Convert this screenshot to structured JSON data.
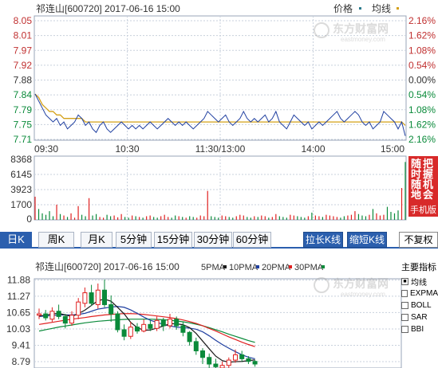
{
  "intraday": {
    "title": "祁连山[600720] 2017-06-16 15:00",
    "legend_price": "价格",
    "legend_avg": "均线",
    "watermark_main": "东方财富网",
    "watermark_sub": "eastmoney.com"
  },
  "kline_header": {
    "title": "祁连山[600720] 2017-06-16 15:00",
    "ma5": "5PMA",
    "ma10": "10PMA",
    "ma20": "20PMA",
    "ma30": "30PMA"
  },
  "tabs": [
    "日K",
    "周K",
    "月K",
    "5分钟",
    "15分钟",
    "30分钟",
    "60分钟"
  ],
  "buttons": {
    "stretch": "拉长K线",
    "shrink": "缩短K线",
    "restore": "不复权"
  },
  "ad": {
    "col1": "随时随地",
    "col2": "把握机会",
    "foot": "手机版"
  },
  "indicators": {
    "title": "主要指标",
    "items": [
      {
        "label": "均线",
        "checked": true
      },
      {
        "label": "EXPMA",
        "checked": false
      },
      {
        "label": "BOLL",
        "checked": false
      },
      {
        "label": "SAR",
        "checked": false
      },
      {
        "label": "BBI",
        "checked": false
      }
    ]
  },
  "colors": {
    "price": "#1f3fa0",
    "avg": "#d4a017",
    "up": "#e02020",
    "down": "#0a8a3a",
    "grid": "#c8d0dc"
  },
  "chart_data": [
    {
      "type": "line",
      "name": "intraday-price",
      "y_ticks": [
        "8.05",
        "8.01",
        "7.97",
        "7.92",
        "7.88",
        "7.84",
        "7.79",
        "7.75",
        "7.71"
      ],
      "pct_ticks": [
        "2.16%",
        "1.62%",
        "1.08%",
        "0.54%",
        "0.00%",
        "0.54%",
        "1.08%",
        "1.62%",
        "2.16%"
      ],
      "x_ticks": [
        "09:30",
        "10:30",
        "11:30/13:00",
        "14:00",
        "15:00"
      ],
      "ylim": [
        7.71,
        8.05
      ],
      "price": [
        7.84,
        7.82,
        7.8,
        7.78,
        7.77,
        7.76,
        7.77,
        7.75,
        7.76,
        7.74,
        7.75,
        7.76,
        7.78,
        7.77,
        7.75,
        7.76,
        7.74,
        7.73,
        7.75,
        7.76,
        7.74,
        7.73,
        7.74,
        7.75,
        7.76,
        7.75,
        7.74,
        7.75,
        7.74,
        7.75,
        7.74,
        7.75,
        7.76,
        7.75,
        7.74,
        7.75,
        7.76,
        7.77,
        7.76,
        7.75,
        7.76,
        7.75,
        7.76,
        7.75,
        7.74,
        7.75,
        7.76,
        7.77,
        7.79,
        7.78,
        7.77,
        7.76,
        7.77,
        7.78,
        7.76,
        7.75,
        7.76,
        7.77,
        7.79,
        7.77,
        7.76,
        7.77,
        7.76,
        7.77,
        7.78,
        7.76,
        7.77,
        7.79,
        7.76,
        7.75,
        7.74,
        7.76,
        7.78,
        7.77,
        7.76,
        7.75,
        7.76,
        7.74,
        7.75,
        7.76,
        7.75,
        7.76,
        7.77,
        7.78,
        7.79,
        7.77,
        7.76,
        7.77,
        7.78,
        7.79,
        7.78,
        7.76,
        7.75,
        7.76,
        7.74,
        7.75,
        7.76,
        7.79,
        7.78,
        7.77,
        7.76,
        7.74,
        7.76,
        7.72
      ],
      "avg": [
        7.84,
        7.83,
        7.81,
        7.8,
        7.79,
        7.79,
        7.78,
        7.78,
        7.77,
        7.77,
        7.77,
        7.77,
        7.77,
        7.77,
        7.76,
        7.76,
        7.76,
        7.76,
        7.76,
        7.76,
        7.76,
        7.76,
        7.76,
        7.76,
        7.76,
        7.76,
        7.76,
        7.76,
        7.76,
        7.76,
        7.76,
        7.76,
        7.76,
        7.76,
        7.76,
        7.76,
        7.76,
        7.76,
        7.76,
        7.76,
        7.76,
        7.76,
        7.76,
        7.76,
        7.76,
        7.76,
        7.76,
        7.76,
        7.76,
        7.76,
        7.76,
        7.76,
        7.76,
        7.76,
        7.76,
        7.76,
        7.76,
        7.76,
        7.76,
        7.76,
        7.76,
        7.76,
        7.76,
        7.76,
        7.76,
        7.76,
        7.76,
        7.76,
        7.76,
        7.76,
        7.76,
        7.76,
        7.76,
        7.76,
        7.76,
        7.76,
        7.76,
        7.76,
        7.76,
        7.76,
        7.76,
        7.76,
        7.76,
        7.76,
        7.76,
        7.76,
        7.76,
        7.76,
        7.76,
        7.76,
        7.76,
        7.76,
        7.76,
        7.76,
        7.76,
        7.76,
        7.76,
        7.76,
        7.76,
        7.76,
        7.76,
        7.76,
        7.76,
        7.75
      ]
    },
    {
      "type": "bar",
      "name": "intraday-volume",
      "y_ticks": [
        "8368",
        "6145",
        "3923",
        "1700",
        "0"
      ],
      "ylim": [
        0,
        8368
      ],
      "values": [
        3200,
        1500,
        900,
        700,
        1200,
        500,
        2100,
        800,
        600,
        400,
        900,
        300,
        1900,
        700,
        500,
        3000,
        600,
        800,
        400,
        300,
        700,
        500,
        600,
        350,
        800,
        400,
        300,
        600,
        500,
        400,
        300,
        500,
        600,
        400,
        300,
        500,
        700,
        400,
        300,
        600,
        500,
        400,
        300,
        500,
        400,
        300,
        600,
        500,
        4000,
        500,
        400,
        300,
        600,
        500,
        400,
        300,
        500,
        700,
        600,
        400,
        300,
        500,
        400,
        600,
        500,
        300,
        400,
        800,
        500,
        400,
        300,
        700,
        600,
        500,
        400,
        300,
        500,
        1000,
        600,
        500,
        400,
        700,
        600,
        500,
        400,
        300,
        500,
        600,
        700,
        1200,
        800,
        600,
        500,
        700,
        1500,
        900,
        600,
        700,
        1800,
        1100,
        900,
        1300,
        4400,
        8000
      ]
    },
    {
      "type": "candlestick",
      "name": "daily-kline",
      "y_ticks": [
        "11.88",
        "11.27",
        "10.65",
        "10.03",
        "9.41",
        "8.79"
      ],
      "ylim": [
        8.55,
        12.05
      ],
      "candles": [
        [
          10.55,
          10.6,
          10.8,
          10.4
        ],
        [
          10.6,
          10.45,
          10.75,
          10.35
        ],
        [
          10.4,
          10.7,
          10.85,
          10.3
        ],
        [
          10.7,
          10.5,
          10.95,
          10.4
        ],
        [
          10.5,
          10.25,
          10.6,
          10.05
        ],
        [
          10.25,
          10.55,
          10.7,
          10.15
        ],
        [
          10.55,
          11.05,
          11.2,
          10.4
        ],
        [
          11.0,
          11.4,
          11.6,
          10.85
        ],
        [
          11.4,
          11.0,
          11.7,
          10.9
        ],
        [
          10.95,
          11.5,
          11.75,
          10.8
        ],
        [
          11.5,
          10.95,
          11.9,
          10.85
        ],
        [
          10.95,
          10.6,
          11.3,
          10.3
        ],
        [
          10.6,
          10.0,
          10.7,
          9.9
        ],
        [
          10.0,
          9.75,
          10.2,
          9.6
        ],
        [
          9.75,
          10.1,
          10.3,
          9.65
        ],
        [
          10.1,
          9.95,
          10.25,
          9.85
        ],
        [
          9.95,
          10.2,
          10.4,
          9.9
        ],
        [
          10.2,
          10.05,
          10.35,
          9.95
        ],
        [
          10.05,
          10.35,
          10.5,
          9.95
        ],
        [
          10.35,
          10.15,
          10.45,
          9.95
        ],
        [
          10.15,
          10.4,
          10.6,
          10.05
        ],
        [
          10.4,
          10.15,
          10.5,
          10.0
        ],
        [
          10.15,
          9.9,
          10.3,
          9.75
        ],
        [
          9.9,
          9.55,
          9.95,
          9.4
        ],
        [
          9.55,
          9.2,
          9.7,
          9.05
        ],
        [
          9.2,
          8.95,
          9.3,
          8.7
        ],
        [
          8.95,
          8.7,
          9.1,
          8.55
        ],
        [
          8.7,
          8.6,
          8.9,
          8.45
        ],
        [
          8.55,
          8.65,
          8.8,
          8.45
        ],
        [
          8.65,
          8.85,
          8.95,
          8.55
        ],
        [
          8.85,
          9.05,
          9.25,
          8.75
        ],
        [
          9.05,
          8.9,
          9.2,
          8.8
        ],
        [
          8.9,
          8.8,
          9.0,
          8.7
        ],
        [
          8.8,
          8.7,
          8.85,
          8.6
        ]
      ],
      "ma5": [
        10.52,
        10.55,
        10.6,
        10.62,
        10.56,
        10.5,
        10.61,
        10.74,
        10.92,
        11.1,
        11.16,
        11.08,
        10.85,
        10.6,
        10.28,
        10.08,
        9.98,
        9.99,
        10.06,
        10.14,
        10.23,
        10.22,
        10.19,
        10.08,
        9.86,
        9.57,
        9.28,
        9.0,
        8.83,
        8.77,
        8.79,
        8.8,
        8.83,
        8.86
      ],
      "ma10": [
        10.5,
        10.52,
        10.54,
        10.56,
        10.56,
        10.56,
        10.58,
        10.62,
        10.7,
        10.78,
        10.82,
        10.86,
        10.88,
        10.85,
        10.75,
        10.62,
        10.48,
        10.36,
        10.28,
        10.2,
        10.14,
        10.1,
        10.08,
        10.06,
        10.02,
        9.92,
        9.77,
        9.6,
        9.44,
        9.3,
        9.17,
        9.05,
        8.96,
        8.9
      ],
      "ma20": [
        10.2,
        10.24,
        10.28,
        10.32,
        10.36,
        10.4,
        10.43,
        10.46,
        10.5,
        10.53,
        10.56,
        10.58,
        10.6,
        10.61,
        10.61,
        10.6,
        10.58,
        10.55,
        10.52,
        10.49,
        10.46,
        10.42,
        10.37,
        10.31,
        10.24,
        10.15,
        10.05,
        9.95,
        9.84,
        9.73,
        9.63,
        9.53,
        9.44,
        9.36
      ],
      "ma30": [
        9.95,
        10.0,
        10.05,
        10.1,
        10.14,
        10.18,
        10.22,
        10.26,
        10.29,
        10.32,
        10.34,
        10.36,
        10.38,
        10.39,
        10.4,
        10.4,
        10.4,
        10.4,
        10.39,
        10.38,
        10.36,
        10.33,
        10.3,
        10.26,
        10.21,
        10.15,
        10.08,
        10.0,
        9.92,
        9.83,
        9.75,
        9.67,
        9.59,
        9.52
      ]
    }
  ]
}
